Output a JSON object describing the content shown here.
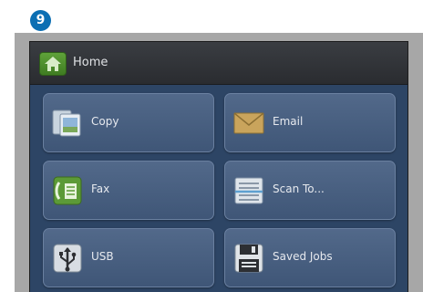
{
  "step_badge": "9",
  "title_bar": {
    "title": "Home",
    "icon": "home-icon"
  },
  "tiles": [
    {
      "label": "Copy",
      "icon": "copy-icon"
    },
    {
      "label": "Email",
      "icon": "email-icon"
    },
    {
      "label": "Fax",
      "icon": "fax-icon"
    },
    {
      "label": "Scan To...",
      "icon": "scan-to-icon"
    },
    {
      "label": "USB",
      "icon": "usb-icon"
    },
    {
      "label": "Saved Jobs",
      "icon": "saved-jobs-icon"
    }
  ],
  "colors": {
    "badge": "#0c6fb3",
    "home_icon": "#4f9130",
    "tile_face": "#4b6283",
    "screen_background": "#2d4565"
  }
}
